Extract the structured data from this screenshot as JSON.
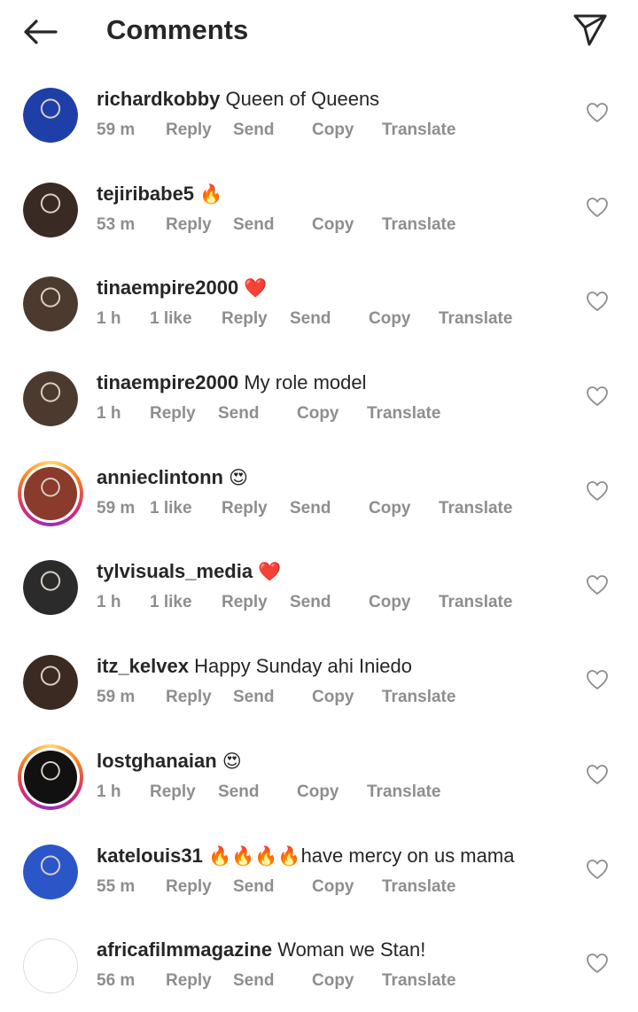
{
  "header": {
    "title": "Comments"
  },
  "comments": [
    {
      "username": "richardkobby",
      "text": "Queen of Queens",
      "emoji": "",
      "time": "59 m",
      "likes": "",
      "actions": [
        "Reply",
        "Send",
        "Copy",
        "Translate"
      ],
      "story": false,
      "avatar_color": "#1f3fa8"
    },
    {
      "username": "tejiribabe5",
      "text": "",
      "emoji": "🔥",
      "time": "53 m",
      "likes": "",
      "actions": [
        "Reply",
        "Send",
        "Copy",
        "Translate"
      ],
      "story": false,
      "avatar_color": "#3a2a24"
    },
    {
      "username": "tinaempire2000",
      "text": "",
      "emoji": "❤️",
      "time": "1 h",
      "likes": "1 like",
      "actions": [
        "Reply",
        "Send",
        "Copy",
        "Translate"
      ],
      "story": false,
      "avatar_color": "#4c3a2e"
    },
    {
      "username": "tinaempire2000",
      "text": "My role model",
      "emoji": "",
      "time": "1 h",
      "likes": "",
      "actions": [
        "Reply",
        "Send",
        "Copy",
        "Translate"
      ],
      "story": false,
      "avatar_color": "#4c3a2e"
    },
    {
      "username": "annieclintonn",
      "text": "",
      "emoji": "😍",
      "time": "59 m",
      "likes": "1 like",
      "actions": [
        "Reply",
        "Send",
        "Copy",
        "Translate"
      ],
      "story": true,
      "avatar_color": "#8a3b2b"
    },
    {
      "username": "tylvisuals_media",
      "text": "",
      "emoji": "❤️",
      "time": "1 h",
      "likes": "1 like",
      "actions": [
        "Reply",
        "Send",
        "Copy",
        "Translate"
      ],
      "story": false,
      "avatar_color": "#2b2b2b"
    },
    {
      "username": "itz_kelvex",
      "text": "Happy Sunday ahi Iniedo",
      "emoji": "",
      "time": "59 m",
      "likes": "",
      "actions": [
        "Reply",
        "Send",
        "Copy",
        "Translate"
      ],
      "story": false,
      "avatar_color": "#3b2a22"
    },
    {
      "username": "lostghanaian",
      "text": "",
      "emoji": "😍",
      "time": "1 h",
      "likes": "",
      "actions": [
        "Reply",
        "Send",
        "Copy",
        "Translate"
      ],
      "story": true,
      "avatar_color": "#111111"
    },
    {
      "username": "katelouis31",
      "text": "have mercy on us mama",
      "emoji": "🔥🔥🔥🔥",
      "time": "55 m",
      "likes": "",
      "actions": [
        "Reply",
        "Send",
        "Copy",
        "Translate"
      ],
      "story": false,
      "avatar_color": "#2a56c7"
    },
    {
      "username": "africafilmmagazine",
      "text": "Woman we Stan!",
      "emoji": "",
      "time": "56 m",
      "likes": "",
      "actions": [
        "Reply",
        "Send",
        "Copy",
        "Translate"
      ],
      "story": false,
      "avatar_color": "#ffffff"
    }
  ]
}
